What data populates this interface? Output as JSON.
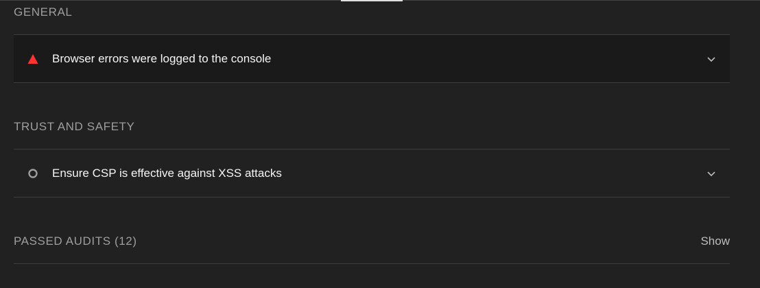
{
  "sections": {
    "general": {
      "title": "GENERAL",
      "audit": {
        "title": "Browser errors were logged to the console",
        "status": "fail",
        "status_color": "#ff3333",
        "icon": "warning-triangle-icon"
      }
    },
    "trust": {
      "title": "TRUST AND SAFETY",
      "audit": {
        "title": "Ensure CSP is effective against XSS attacks",
        "status": "informative",
        "status_color": "#9e9e9e",
        "icon": "circle-outline-icon"
      }
    },
    "passed": {
      "title": "PASSED AUDITS (12)",
      "toggle_label": "Show"
    }
  },
  "colors": {
    "background": "#212121",
    "row_highlight": "#1a1a1a",
    "divider": "#3d3d3d",
    "section_title": "#9e9e9e",
    "text": "#f5f5f5"
  }
}
